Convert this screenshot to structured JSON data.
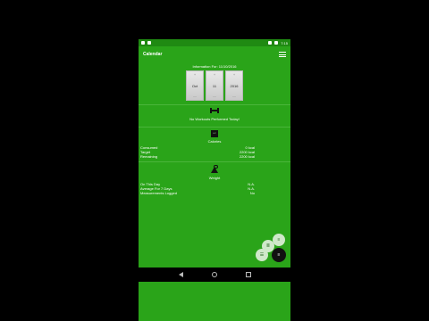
{
  "status_bar": {
    "time": "7:15"
  },
  "app_bar": {
    "title": "Calendar"
  },
  "info": {
    "text": "Information For: 11/10/2016"
  },
  "date_picker": {
    "month": "Oct",
    "day": "11",
    "year": "2016",
    "up_glyph": "+",
    "down_glyph": "—"
  },
  "workouts": {
    "message": "No Workouts Performed Today!"
  },
  "calories": {
    "icon_text": "EAT",
    "label": "Calories",
    "rows": [
      {
        "label": "Consumed",
        "value": "0 kcal"
      },
      {
        "label": "Target",
        "value": "2200 kcal"
      },
      {
        "label": "Remaining",
        "value": "2200 kcal"
      }
    ]
  },
  "weight": {
    "label": "Weight",
    "rows": [
      {
        "label": "On This Day",
        "value": "N.A."
      },
      {
        "label": "Average For 7 Days",
        "value": "N.A."
      },
      {
        "label": "Measurements Logged",
        "value": "No"
      }
    ]
  },
  "fabs": {
    "a": "≡",
    "b": "≣",
    "c": "☰",
    "main": "≡"
  },
  "colors": {
    "primary": "#2aa419",
    "status": "#1f8a12",
    "fab_main": "#111111"
  },
  "icons": [
    "dumbbell-icon",
    "calorie-icon",
    "weight-icon",
    "menu-icon"
  ]
}
